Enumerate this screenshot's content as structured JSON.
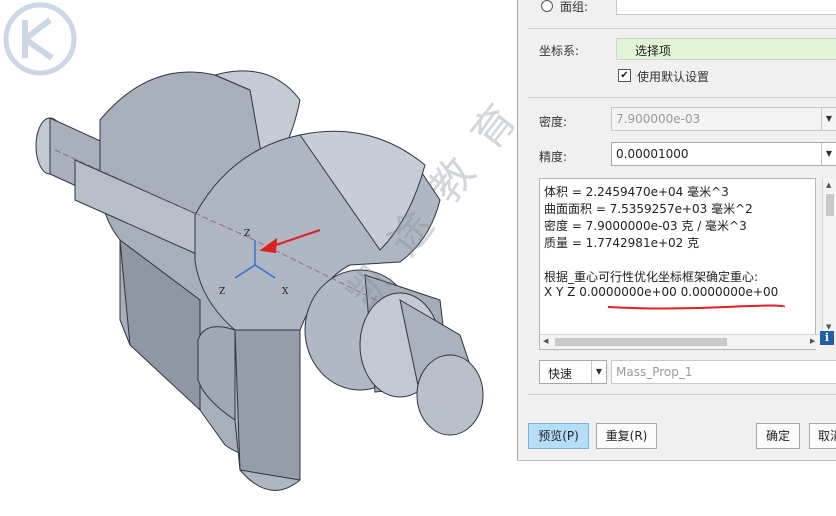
{
  "panel": {
    "face_group_label": "面组:",
    "coord_system_label": "坐标系:",
    "coord_system_value": "选择项",
    "use_default_label": "使用默认设置",
    "use_default_checked": "✔",
    "density_label": "密度:",
    "density_value": "7.900000e-03",
    "precision_label": "精度:",
    "precision_value": "0.00001000",
    "results": {
      "volume": "体积 = 2.2459470e+04 毫米^3",
      "surface_area": "曲面面积 = 7.5359257e+03 毫米^2",
      "density": "密度 = 7.9000000e-03 克 / 毫米^3",
      "mass": "质量 = 1.7742981e+02 克",
      "centroid_heading": "根据_重心可行性优化坐标框架确定重心:",
      "centroid_xyz": "X Y Z    0.0000000e+00   0.0000000e+00"
    },
    "mode_value": "快速",
    "name_value": "Mass_Prop_1",
    "buttons": {
      "preview": "预览(P)",
      "repeat": "重复(R)",
      "ok": "确定",
      "cancel": "取消"
    }
  },
  "viewport": {
    "watermark_text": "凯 途 教 育"
  },
  "colors": {
    "model_face": "#b9c0ca",
    "model_shadow": "#8d95a1",
    "annotation_red": "#e02020",
    "accent_select": "#e1f5d6"
  }
}
